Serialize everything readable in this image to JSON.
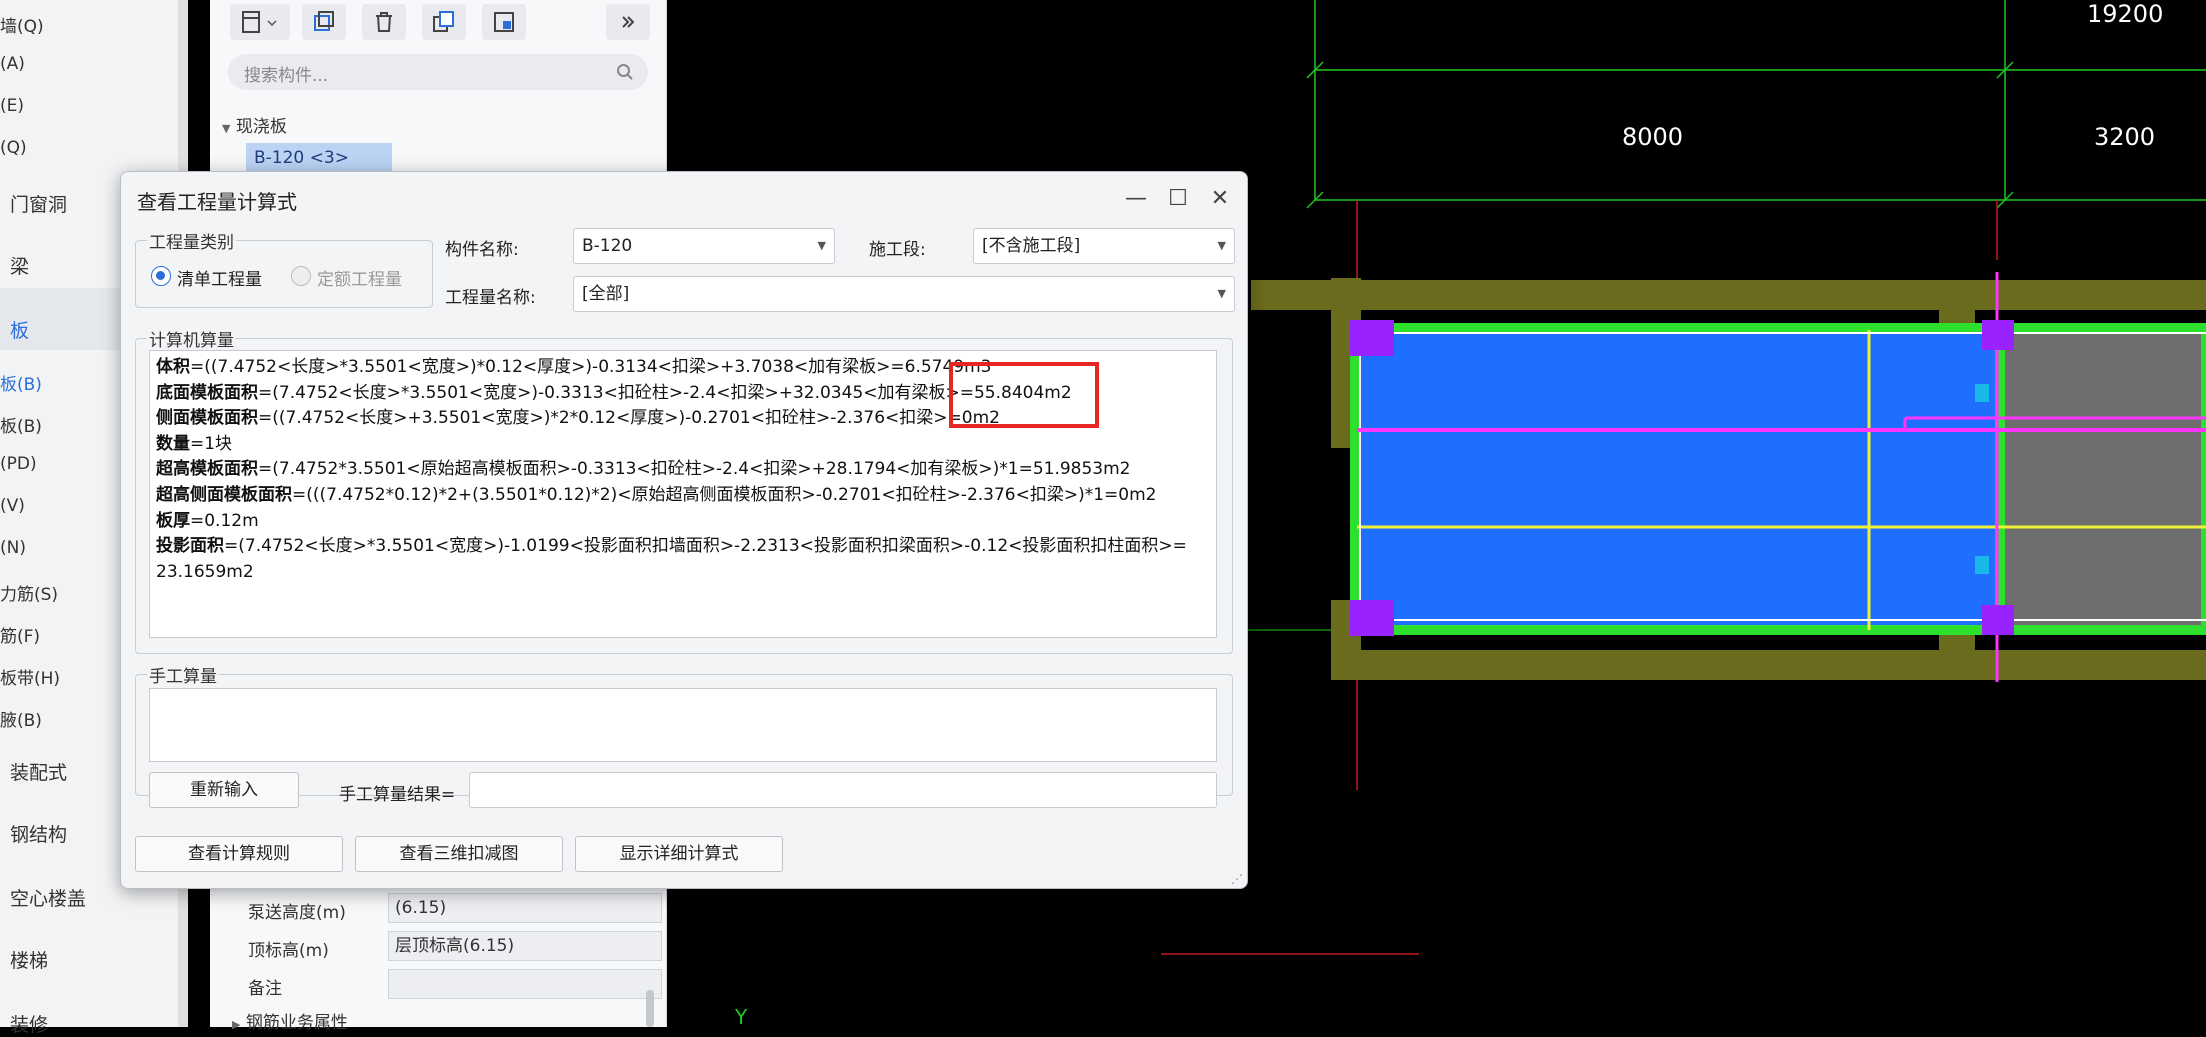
{
  "left_nav": {
    "items": [
      {
        "label": "墙(Q)",
        "kind": "small"
      },
      {
        "label": "(A)",
        "kind": "small"
      },
      {
        "label": "(E)",
        "kind": "small"
      },
      {
        "label": "(Q)",
        "kind": "small"
      },
      {
        "label": "门窗洞",
        "kind": "big"
      },
      {
        "label": "梁",
        "kind": "big"
      },
      {
        "label": "板",
        "kind": "big-active"
      },
      {
        "label": "板(B)",
        "kind": "small-active"
      },
      {
        "label": "板(B)",
        "kind": "small"
      },
      {
        "label": "(PD)",
        "kind": "small"
      },
      {
        "label": "(V)",
        "kind": "small"
      },
      {
        "label": "(N)",
        "kind": "small"
      },
      {
        "label": "力筋(S)",
        "kind": "small"
      },
      {
        "label": "筋(F)",
        "kind": "small"
      },
      {
        "label": "板带(H)",
        "kind": "small"
      },
      {
        "label": "腋(B)",
        "kind": "small"
      },
      {
        "label": "装配式",
        "kind": "big"
      },
      {
        "label": "钢结构",
        "kind": "big"
      },
      {
        "label": "空心楼盖",
        "kind": "big"
      },
      {
        "label": "楼梯",
        "kind": "big"
      },
      {
        "label": "装修",
        "kind": "big"
      }
    ]
  },
  "panel": {
    "search_placeholder": "搜索构件...",
    "tree_group": "现浇板",
    "selected_item": "B-120 <3>",
    "properties": [
      {
        "label": "泵送高度(m)",
        "value": "(6.15)"
      },
      {
        "label": "顶标高(m)",
        "value": "层顶标高(6.15)"
      },
      {
        "label": "备注",
        "value": ""
      }
    ],
    "more_group": "钢筋业务属性"
  },
  "cad": {
    "dims": {
      "top": "19200",
      "left": "8000",
      "right": "3200"
    },
    "axis_label": "Y"
  },
  "dialog": {
    "title": "查看工程量计算式",
    "quantity_type_group": "工程量类别",
    "radio_list": "清单工程量",
    "radio_quota": "定额工程量",
    "component_name_label": "构件名称:",
    "component_name_value": "B-120",
    "stage_label": "施工段:",
    "stage_value": "[不含施工段]",
    "quantity_name_label": "工程量名称:",
    "quantity_name_value": "[全部]",
    "computer_group": "计算机算量",
    "formulas": [
      {
        "name": "体积",
        "expr": "=((7.4752<长度>*3.5501<宽度>)*0.12<厚度>)-0.3134<扣梁>+3.7038<加有梁板>=6.5749m3"
      },
      {
        "name": "底面模板面积",
        "expr": "=(7.4752<长度>*3.5501<宽度>)-0.3313<扣砼柱>-2.4<扣梁>+32.0345<加有梁板>=55.8404m2"
      },
      {
        "name": "侧面模板面积",
        "expr": "=((7.4752<长度>+3.5501<宽度>)*2*0.12<厚度>)-0.2701<扣砼柱>-2.376<扣梁>=0m2"
      },
      {
        "name": "数量",
        "expr": "=1块"
      },
      {
        "name": "超高模板面积",
        "expr": "=(7.4752*3.5501<原始超高模板面积>-0.3313<扣砼柱>-2.4<扣梁>+28.1794<加有梁板>)*1=51.9853m2"
      },
      {
        "name": "超高侧面模板面积",
        "expr": "=(((7.4752*0.12)*2+(3.5501*0.12)*2)<原始超高侧面模板面积>-0.2701<扣砼柱>-2.376<扣梁>)*1=0m2"
      },
      {
        "name": "板厚",
        "expr": "=0.12m"
      },
      {
        "name": "投影面积",
        "expr": "=(7.4752<长度>*3.5501<宽度>)-1.0199<投影面积扣墙面积>-2.2313<投影面积扣梁面积>-0.12<投影面积扣柱面积>="
      },
      {
        "name": "",
        "expr": "23.1659m2"
      }
    ],
    "manual_group": "手工算量",
    "reenter_button": "重新输入",
    "manual_result_label": "手工算量结果=",
    "manual_result_value": "",
    "btn_rules": "查看计算规则",
    "btn_3d": "查看三维扣减图",
    "btn_detail": "显示详细计算式"
  }
}
